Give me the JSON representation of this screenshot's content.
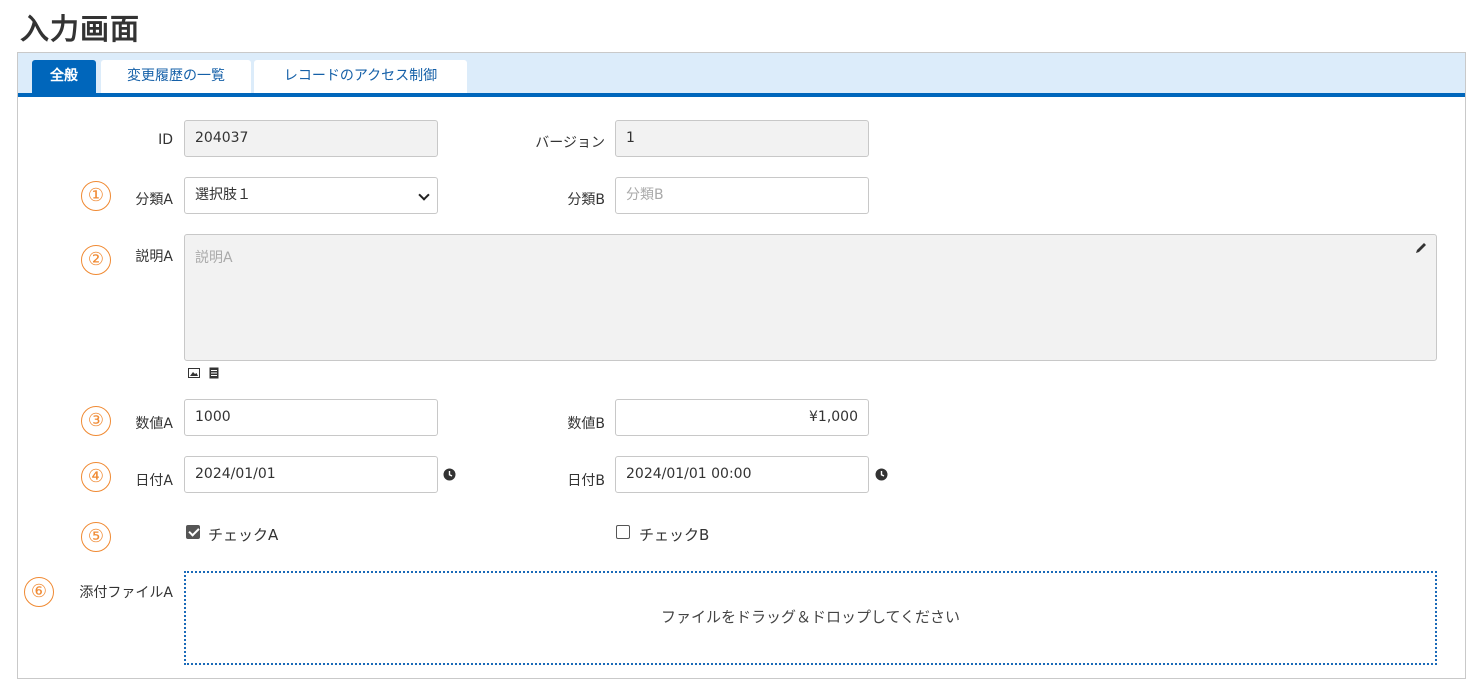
{
  "page_title": "入力画面",
  "tabs": [
    {
      "label": "全般",
      "active": true
    },
    {
      "label": "変更履歴の一覧",
      "active": false
    },
    {
      "label": "レコードのアクセス制御",
      "active": false
    }
  ],
  "markers": [
    "①",
    "②",
    "③",
    "④",
    "⑤",
    "⑥"
  ],
  "fields": {
    "id": {
      "label": "ID",
      "value": "204037"
    },
    "version": {
      "label": "バージョン",
      "value": "1"
    },
    "class_a": {
      "label": "分類A",
      "value": "選択肢１"
    },
    "class_b": {
      "label": "分類B",
      "placeholder": "分類B"
    },
    "desc_a": {
      "label": "説明A",
      "placeholder": "説明A"
    },
    "num_a": {
      "label": "数値A",
      "value": "1000"
    },
    "num_b": {
      "label": "数値B",
      "value": "¥1,000"
    },
    "date_a": {
      "label": "日付A",
      "value": "2024/01/01"
    },
    "date_b": {
      "label": "日付B",
      "value": "2024/01/01 00:00"
    },
    "check_a": {
      "label": "チェックA",
      "checked": true
    },
    "check_b": {
      "label": "チェックB",
      "checked": false
    },
    "attach_a": {
      "label": "添付ファイルA",
      "drop_text": "ファイルをドラッグ＆ドロップしてください"
    }
  },
  "icons": {
    "edit": "pencil-icon",
    "image": "image-icon",
    "file": "file-icon",
    "clock": "clock-icon"
  },
  "colors": {
    "accent": "#0066bb",
    "tabbar_bg": "#dcecfa",
    "marker": "#f08a33",
    "readonly_bg": "#f2f2f2"
  }
}
